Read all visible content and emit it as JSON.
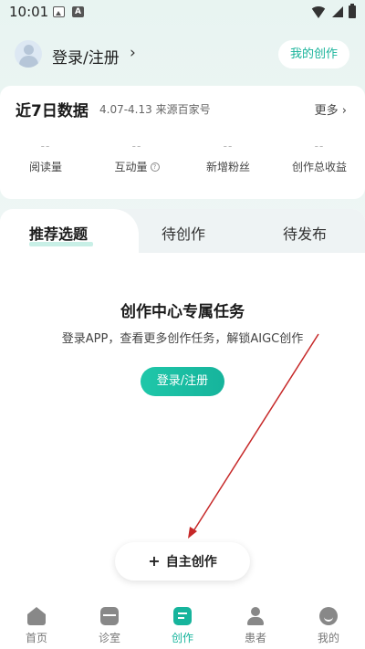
{
  "status_bar": {
    "time": "10:01"
  },
  "header": {
    "login_text": "登录/注册",
    "chevron": "›",
    "my_creation": "我的创作"
  },
  "data_card": {
    "title": "近7日数据",
    "range": "4.07-4.13 来源百家号",
    "more": "更多 ›",
    "stats": [
      {
        "value": "--",
        "label": "阅读量"
      },
      {
        "value": "--",
        "label": "互动量"
      },
      {
        "value": "--",
        "label": "新增粉丝"
      },
      {
        "value": "--",
        "label": "创作总收益"
      }
    ]
  },
  "tabs": [
    {
      "label": "推荐选题",
      "active": true
    },
    {
      "label": "待创作"
    },
    {
      "label": "待发布"
    }
  ],
  "task": {
    "title": "创作中心专属任务",
    "description": "登录APP，查看更多创作任务，解锁AIGC创作",
    "login_button": "登录/注册"
  },
  "self_create": {
    "plus": "+",
    "label": "自主创作"
  },
  "bottom_nav": [
    {
      "label": "首页",
      "icon": "home-icon"
    },
    {
      "label": "诊室",
      "icon": "clinic-icon"
    },
    {
      "label": "创作",
      "icon": "create-icon",
      "active": true
    },
    {
      "label": "患者",
      "icon": "patient-icon"
    },
    {
      "label": "我的",
      "icon": "profile-icon"
    }
  ],
  "colors": {
    "accent": "#16b49c",
    "annotation_arrow": "#c62828"
  }
}
